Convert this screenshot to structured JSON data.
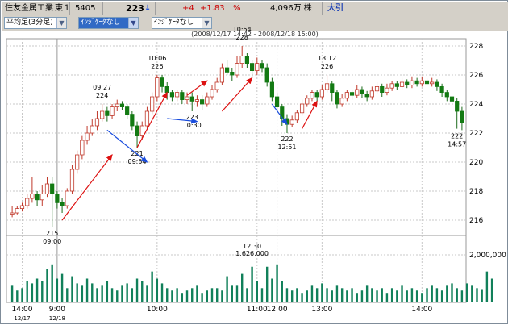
{
  "header": {
    "name": "住友金属工業",
    "market": "東１",
    "code": "5405",
    "price": "223",
    "trend_icon": "down-arrow-icon",
    "change": "+4",
    "change_pct": "+1.83",
    "pct_unit": "%",
    "volume_text": "4,096万 株",
    "closing_status": "大引"
  },
  "toolbar": {
    "chart_type": "平均足(3分足)",
    "indicator1": "ｲﾝｼﾞｹｰﾀなし",
    "indicator2": "ｲﾝｼﾞｹｰﾀなし"
  },
  "period": "(2008/12/17 14:42 - 2008/12/18 15:00)",
  "colors": {
    "up": "#2e9e2e",
    "down": "#137a13",
    "red_arrow": "#dd1111",
    "blue_arrow": "#1a4ddd",
    "volume": "#11805a",
    "text_up": "#cc0000",
    "trend_icon": "#1a4ddd"
  },
  "chart_data": {
    "type": "candlestick",
    "y_ticks": [
      "228",
      "226",
      "224",
      "222",
      "220",
      "218",
      "216"
    ],
    "ylim": [
      215,
      228.5
    ],
    "volume_tick": "2,000,000",
    "x_ticks": [
      {
        "label": "14:00",
        "sub": "12/17",
        "idx": 2
      },
      {
        "label": "9:00",
        "sub": "12/18",
        "idx": 9
      },
      {
        "label": "10:00",
        "sub": "",
        "idx": 29
      },
      {
        "label": "11:00",
        "sub": "",
        "idx": 49
      },
      {
        "label": "12:00",
        "sub": "",
        "idx": 53
      },
      {
        "label": "13:00",
        "sub": "",
        "idx": 62
      },
      {
        "label": "14:00",
        "sub": "",
        "idx": 82
      }
    ],
    "candles": [
      [
        216.5,
        216.5,
        216.2,
        217.0
      ],
      [
        216.5,
        216.8,
        216.4,
        217.0
      ],
      [
        216.8,
        217.0,
        216.6,
        217.2
      ],
      [
        217.0,
        217.5,
        216.8,
        217.8
      ],
      [
        217.5,
        217.8,
        217.2,
        219.0
      ],
      [
        217.8,
        217.4,
        217.0,
        218.0
      ],
      [
        217.4,
        217.8,
        217.0,
        218.4
      ],
      [
        217.8,
        218.5,
        217.6,
        219.0
      ],
      [
        218.5,
        217.8,
        215.5,
        219.0
      ],
      [
        217.8,
        217.2,
        216.8,
        218.0
      ],
      [
        217.2,
        217.0,
        216.5,
        217.5
      ],
      [
        217.0,
        218.0,
        216.8,
        218.2
      ],
      [
        218.0,
        219.5,
        217.8,
        219.8
      ],
      [
        219.5,
        220.5,
        219.2,
        220.8
      ],
      [
        220.5,
        221.5,
        220.2,
        221.8
      ],
      [
        221.5,
        222.0,
        221.2,
        222.5
      ],
      [
        222.0,
        222.5,
        221.8,
        223.0
      ],
      [
        222.5,
        223.0,
        222.2,
        223.5
      ],
      [
        223.0,
        223.5,
        222.8,
        224.0
      ],
      [
        223.5,
        223.2,
        222.8,
        223.8
      ],
      [
        223.2,
        223.8,
        223.0,
        224.0
      ],
      [
        223.8,
        224.0,
        223.5,
        224.3
      ],
      [
        224.0,
        223.8,
        223.6,
        224.2
      ],
      [
        223.8,
        223.3,
        223.0,
        224.0
      ],
      [
        223.3,
        222.5,
        222.2,
        223.5
      ],
      [
        222.5,
        221.8,
        221.0,
        222.8
      ],
      [
        221.8,
        222.5,
        221.5,
        222.8
      ],
      [
        222.5,
        223.5,
        222.3,
        223.8
      ],
      [
        223.5,
        224.5,
        223.3,
        224.8
      ],
      [
        224.5,
        225.8,
        224.2,
        226.0
      ],
      [
        225.8,
        225.2,
        224.8,
        226.0
      ],
      [
        225.2,
        224.8,
        224.3,
        225.5
      ],
      [
        224.8,
        224.5,
        224.2,
        225.0
      ],
      [
        224.5,
        224.8,
        224.2,
        225.0
      ],
      [
        224.8,
        224.3,
        224.0,
        225.0
      ],
      [
        224.3,
        224.5,
        224.0,
        224.8
      ],
      [
        224.5,
        224.2,
        223.5,
        224.8
      ],
      [
        224.2,
        224.3,
        223.8,
        224.6
      ],
      [
        224.3,
        224.0,
        223.6,
        224.6
      ],
      [
        224.0,
        224.5,
        223.8,
        224.8
      ],
      [
        224.5,
        225.0,
        224.3,
        225.3
      ],
      [
        225.0,
        225.5,
        224.8,
        225.8
      ],
      [
        225.5,
        226.5,
        225.3,
        226.8
      ],
      [
        226.5,
        226.2,
        226.0,
        227.0
      ],
      [
        226.2,
        226.0,
        225.6,
        226.5
      ],
      [
        226.0,
        226.8,
        225.8,
        227.3
      ],
      [
        226.8,
        227.3,
        226.5,
        228.0
      ],
      [
        227.3,
        226.8,
        226.5,
        227.5
      ],
      [
        226.8,
        226.3,
        225.8,
        227.0
      ],
      [
        226.3,
        226.8,
        226.0,
        227.2
      ],
      [
        226.8,
        226.5,
        226.2,
        227.0
      ],
      [
        226.5,
        225.5,
        225.2,
        226.8
      ],
      [
        225.5,
        224.5,
        224.2,
        225.8
      ],
      [
        224.5,
        223.8,
        223.4,
        224.8
      ],
      [
        223.8,
        223.0,
        222.5,
        224.0
      ],
      [
        223.0,
        222.6,
        222.0,
        223.3
      ],
      [
        222.6,
        222.9,
        222.4,
        223.2
      ],
      [
        222.9,
        223.4,
        222.7,
        223.6
      ],
      [
        223.4,
        224.0,
        223.2,
        224.3
      ],
      [
        224.0,
        224.4,
        223.8,
        224.6
      ],
      [
        224.4,
        224.8,
        224.2,
        225.0
      ],
      [
        224.8,
        224.5,
        224.2,
        225.0
      ],
      [
        224.5,
        225.0,
        224.3,
        225.3
      ],
      [
        225.0,
        225.4,
        224.8,
        226.0
      ],
      [
        225.4,
        224.8,
        224.2,
        225.6
      ],
      [
        224.8,
        224.0,
        223.7,
        225.0
      ],
      [
        224.0,
        224.4,
        223.8,
        224.7
      ],
      [
        224.4,
        224.8,
        224.2,
        225.0
      ],
      [
        224.8,
        224.6,
        224.3,
        225.0
      ],
      [
        224.6,
        225.0,
        224.4,
        225.3
      ],
      [
        225.0,
        224.7,
        224.4,
        225.2
      ],
      [
        224.7,
        224.5,
        224.2,
        224.9
      ],
      [
        224.5,
        224.9,
        224.3,
        225.2
      ],
      [
        224.9,
        225.2,
        224.7,
        225.5
      ],
      [
        225.2,
        224.8,
        224.5,
        225.4
      ],
      [
        224.8,
        225.1,
        224.6,
        225.4
      ],
      [
        225.1,
        225.4,
        224.9,
        225.6
      ],
      [
        225.4,
        225.2,
        225.0,
        225.6
      ],
      [
        225.2,
        225.5,
        225.0,
        225.8
      ],
      [
        225.5,
        225.3,
        225.1,
        225.7
      ],
      [
        225.3,
        225.6,
        225.1,
        225.9
      ],
      [
        225.6,
        225.4,
        225.2,
        225.8
      ],
      [
        225.4,
        225.6,
        225.2,
        225.9
      ],
      [
        225.6,
        225.4,
        225.2,
        225.8
      ],
      [
        225.4,
        225.5,
        225.2,
        225.8
      ],
      [
        225.5,
        225.2,
        224.9,
        225.7
      ],
      [
        225.2,
        224.8,
        224.5,
        225.4
      ],
      [
        224.8,
        224.5,
        224.2,
        225.0
      ],
      [
        224.5,
        224.2,
        223.9,
        224.7
      ],
      [
        224.2,
        223.5,
        222.3,
        224.4
      ],
      [
        223.5,
        222.7,
        222.2,
        223.8
      ]
    ],
    "volumes": [
      0.35,
      0.25,
      0.3,
      0.45,
      0.4,
      0.5,
      0.45,
      0.7,
      0.8,
      0.5,
      0.6,
      0.3,
      0.55,
      0.4,
      0.35,
      0.5,
      0.4,
      0.3,
      0.35,
      0.45,
      0.3,
      0.25,
      0.35,
      0.4,
      0.3,
      0.5,
      0.45,
      0.35,
      0.65,
      0.5,
      0.4,
      0.3,
      0.25,
      0.3,
      0.2,
      0.25,
      0.3,
      0.35,
      0.2,
      0.25,
      0.3,
      0.3,
      0.25,
      0.55,
      0.35,
      0.35,
      0.6,
      0.3,
      0.75,
      0.45,
      0.3,
      0.75,
      0.5,
      0.8,
      0.45,
      0.3,
      0.25,
      0.3,
      0.2,
      0.25,
      0.35,
      0.3,
      0.4,
      0.3,
      0.25,
      0.35,
      0.3,
      0.25,
      0.3,
      0.2,
      0.25,
      0.35,
      0.3,
      0.25,
      0.3,
      0.2,
      0.3,
      0.25,
      0.35,
      0.25,
      0.3,
      0.25,
      0.2,
      0.3,
      0.35,
      0.3,
      0.25,
      0.35,
      0.4,
      0.3,
      0.25,
      0.4,
      0.35,
      0.3,
      0.28,
      0.65,
      0.5
    ],
    "annotations": [
      {
        "time": "09:00",
        "value": "215",
        "idx": 8,
        "price": 215.5,
        "pos": "below"
      },
      {
        "time": "09:27",
        "value": "224",
        "idx": 18,
        "price": 224.0,
        "pos": "above"
      },
      {
        "time": "09:54",
        "value": "221",
        "idx": 25,
        "price": 221.0,
        "pos": "below"
      },
      {
        "time": "10:06",
        "value": "226",
        "idx": 29,
        "price": 226.0,
        "pos": "above"
      },
      {
        "time": "10:30",
        "value": "223",
        "idx": 36,
        "price": 223.5,
        "pos": "below"
      },
      {
        "time": "10:54",
        "value": "228",
        "idx": 46,
        "price": 228.0,
        "pos": "above"
      },
      {
        "time": "12:51",
        "value": "222",
        "idx": 55,
        "price": 222.0,
        "pos": "below"
      },
      {
        "time": "13:12",
        "value": "226",
        "idx": 63,
        "price": 226.0,
        "pos": "above"
      },
      {
        "time": "14:57",
        "value": "222",
        "idx": 89,
        "price": 222.2,
        "pos": "below"
      }
    ],
    "volume_annotation": {
      "time": "12:30",
      "value": "1,626,000",
      "idx": 48
    }
  }
}
